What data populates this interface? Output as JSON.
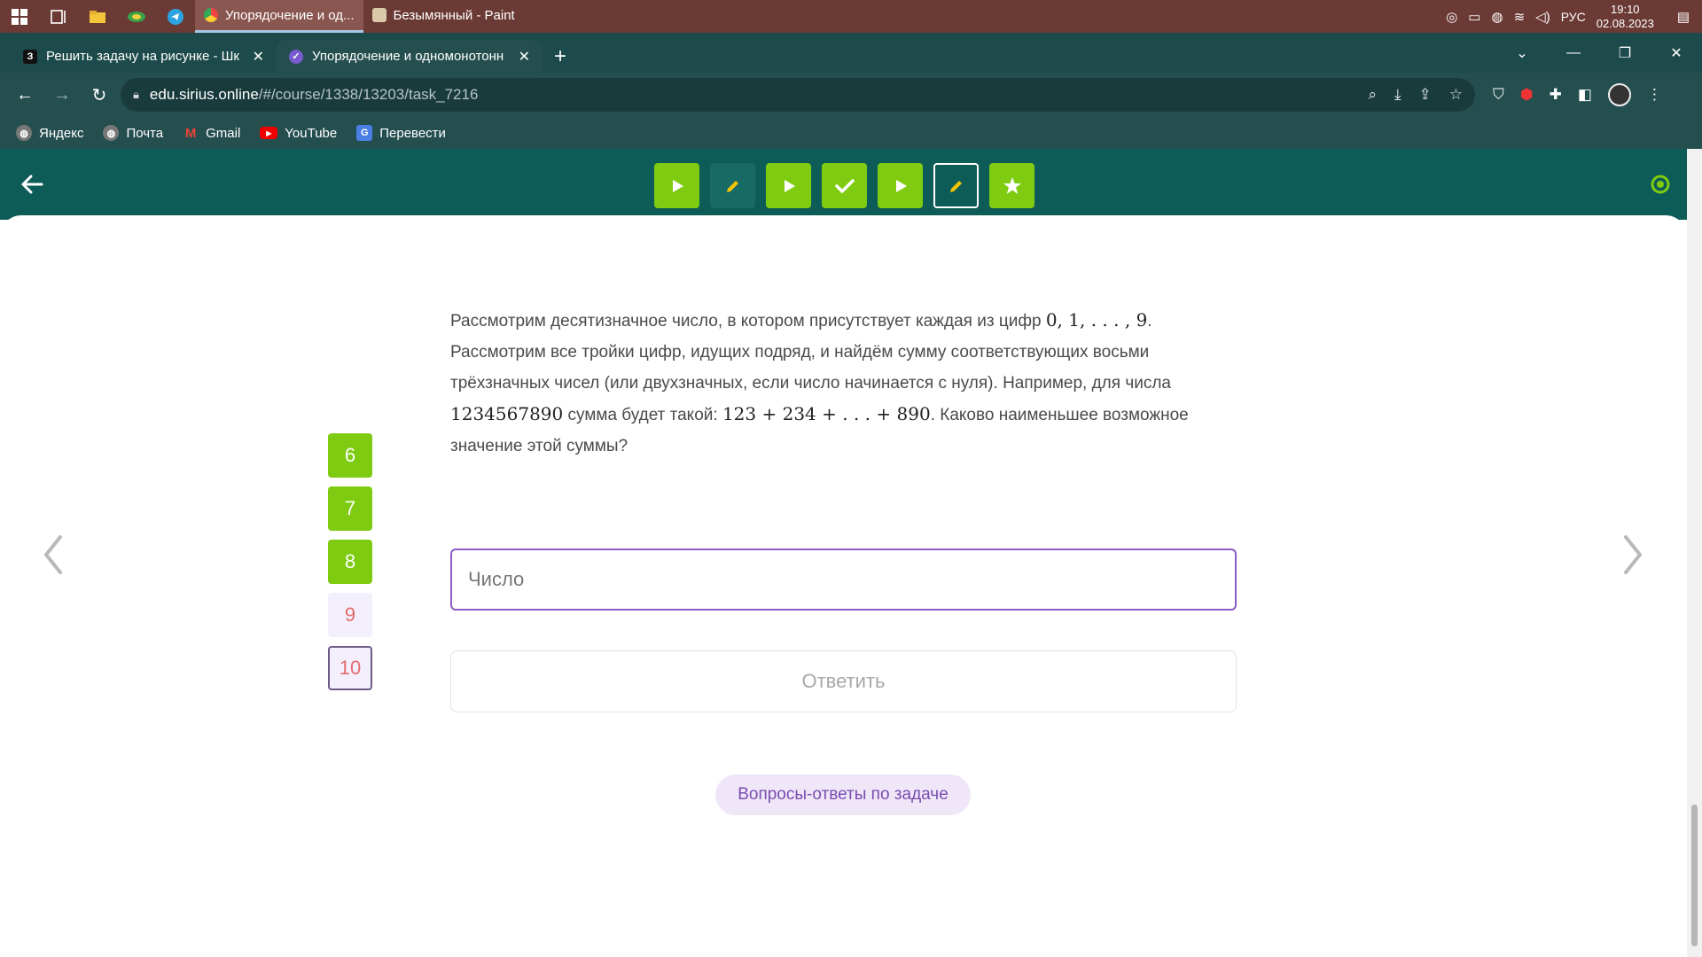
{
  "taskbar": {
    "apps": [
      {
        "label": "Упорядочение и од...",
        "active": true
      },
      {
        "label": "Безымянный - Paint",
        "active": false
      }
    ],
    "language": "РУС",
    "time": "19:10",
    "date": "02.08.2023"
  },
  "browser": {
    "tabs": [
      {
        "title": "Решить задачу на рисунке - Шк",
        "favicon": "З",
        "active": false
      },
      {
        "title": "Упорядочение и одномонотонн",
        "favicon": "✓",
        "active": true
      }
    ],
    "url_host": "edu.sirius.online",
    "url_path": "/#/course/1338/13203/task_7216",
    "bookmarks": [
      {
        "label": "Яндекс",
        "icon": "globe-icon"
      },
      {
        "label": "Почта",
        "icon": "globe-icon"
      },
      {
        "label": "Gmail",
        "icon": "gmail-icon"
      },
      {
        "label": "YouTube",
        "icon": "youtube-icon"
      },
      {
        "label": "Перевести",
        "icon": "translate-icon"
      }
    ]
  },
  "course": {
    "steps": [
      {
        "type": "play",
        "state": "done"
      },
      {
        "type": "pencil",
        "state": "dark"
      },
      {
        "type": "play",
        "state": "done"
      },
      {
        "type": "check",
        "state": "done"
      },
      {
        "type": "play",
        "state": "done"
      },
      {
        "type": "pencil",
        "state": "current"
      },
      {
        "type": "star",
        "state": "done"
      }
    ],
    "task_numbers": [
      {
        "label": "6",
        "state": "done"
      },
      {
        "label": "7",
        "state": "done"
      },
      {
        "label": "8",
        "state": "done"
      },
      {
        "label": "9",
        "state": "pending"
      },
      {
        "label": "10",
        "state": "current"
      }
    ]
  },
  "problem": {
    "p1": "Рассмотрим десятизначное число, в котором присутствует каждая из цифр ",
    "m1": "0, 1, . . . , 9",
    "p2": ". Рассмотрим все тройки цифр, идущих подряд, и найдём сумму соответствующих восьми трёхзначных чисел (или двухзначных, если число начинается с нуля). Например, для числа ",
    "m2": "1234567890",
    "p3": " сумма будет такой: ",
    "m3": "123 + 234 + . . . + 890",
    "p4": ". Каково наименьшее возможное значение этой суммы?"
  },
  "answer": {
    "placeholder": "Число",
    "value": "",
    "submit_label": "Ответить"
  },
  "qa_label": "Вопросы-ответы по задаче",
  "colors": {
    "header": "#0e5c57",
    "done": "#7ecb12",
    "accent": "#8a5cc5"
  }
}
